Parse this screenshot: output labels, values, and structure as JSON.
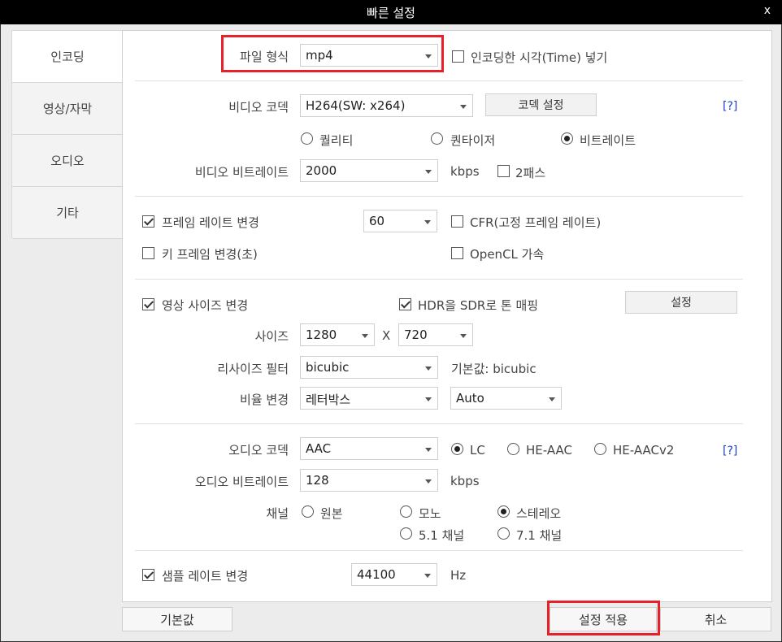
{
  "window": {
    "title": "빠른 설정",
    "close": "x"
  },
  "sidebar": {
    "items": [
      {
        "label": "인코딩"
      },
      {
        "label": "영상/자막"
      },
      {
        "label": "오디오"
      },
      {
        "label": "기타"
      }
    ]
  },
  "format": {
    "label": "파일 형식",
    "value": "mp4",
    "time_checkbox": "인코딩한 시각(Time) 넣기",
    "time_checked": false
  },
  "video": {
    "codec_label": "비디오 코덱",
    "codec_value": "H264(SW: x264)",
    "codec_settings_btn": "코덱 설정",
    "help": "[?]",
    "mode_quality": "퀄리티",
    "mode_quantizer": "퀀타이저",
    "mode_bitrate": "비트레이트",
    "selected_mode": "bitrate",
    "bitrate_label": "비디오 비트레이트",
    "bitrate_value": "2000",
    "bitrate_unit": "kbps",
    "twopass": "2패스",
    "twopass_checked": false
  },
  "frame": {
    "change_fps": "프레임 레이트 변경",
    "change_fps_checked": true,
    "fps_value": "60",
    "cfr": "CFR(고정 프레임 레이트)",
    "cfr_checked": false,
    "keyframe": "키 프레임 변경(초)",
    "keyframe_checked": false,
    "opencl": "OpenCL 가속",
    "opencl_checked": false
  },
  "size": {
    "change_size": "영상 사이즈 변경",
    "change_size_checked": true,
    "hdr": "HDR을 SDR로 톤 매핑",
    "hdr_checked": true,
    "hdr_settings_btn": "설정",
    "size_label": "사이즈",
    "width": "1280",
    "x": "X",
    "height": "720",
    "filter_label": "리사이즈 필터",
    "filter_value": "bicubic",
    "filter_default": "기본값: bicubic",
    "ratio_label": "비율 변경",
    "ratio_value": "레터박스",
    "ratio_mode": "Auto"
  },
  "audio": {
    "codec_label": "오디오 코덱",
    "codec_value": "AAC",
    "help": "[?]",
    "profile_lc": "LC",
    "profile_he": "HE-AAC",
    "profile_hev2": "HE-AACv2",
    "selected_profile": "LC",
    "bitrate_label": "오디오 비트레이트",
    "bitrate_value": "128",
    "bitrate_unit": "kbps",
    "channel_label": "채널",
    "ch_original": "원본",
    "ch_mono": "모노",
    "ch_stereo": "스테레오",
    "ch_51": "5.1 채널",
    "ch_71": "7.1 채널",
    "selected_channel": "stereo",
    "samplerate_change": "샘플 레이트 변경",
    "samplerate_checked": true,
    "samplerate_value": "44100",
    "samplerate_unit": "Hz"
  },
  "footer": {
    "default_btn": "기본값",
    "apply_btn": "설정 적용",
    "cancel_btn": "취소"
  },
  "colors": {
    "highlight": "#e8202a",
    "help_link": "#1a3fc4"
  }
}
